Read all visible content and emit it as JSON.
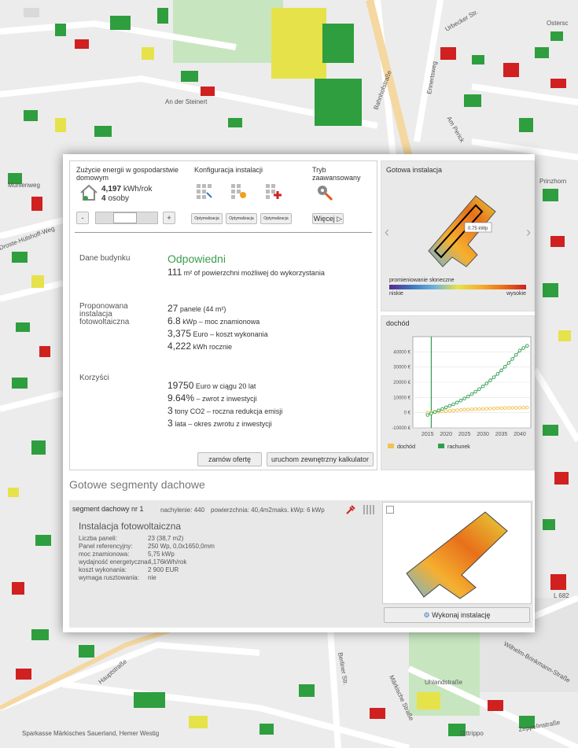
{
  "map": {
    "streets": [
      "An der Steinert",
      "Ennertsweg",
      "Bahnhofstraße",
      "Mühlenweg",
      "Prinzhorn",
      "Am Perick",
      "Hauptstraße",
      "Berliner Str.",
      "Wilhelm-Brinkmann-Straße",
      "Zeppelinstraße",
      "Märkische Straße",
      "Droste-Hülshoff-Weg",
      "Uhlandstraße",
      "L 682",
      "Ostersc",
      "Urbecker Str."
    ],
    "poi_label": "Sparkasse Märkisches Sauerland, Hemer Westig",
    "poi_label2": "Dittrippo"
  },
  "panel": {
    "top": {
      "consumption_title": "Zużycie energii w gospodarstwie domowym",
      "consumption_value": "4,197",
      "consumption_unit": "kWh/rok",
      "persons_value": "4",
      "persons_unit": "osoby",
      "minus": "-",
      "plus": "+",
      "config_title": "Konfiguracja instalacji",
      "config_btn1": "Optymalizacja",
      "config_btn2": "Optymalizacja",
      "config_btn3": "Optymalizacja",
      "advanced_title": "Tryb zaawansowany",
      "more_btn": "Więcej ▷"
    },
    "building": {
      "label": "Dane budynku",
      "status": "Odpowiedni",
      "area_value": "111",
      "area_text": "m² of powierzchni możliwej do wykorzystania"
    },
    "proposal": {
      "label": "Proponowana instalacja fotowoltaiczna",
      "l1_value": "27",
      "l1_text": "panele (44 m²)",
      "l2_value": "6.8",
      "l2_text": "kWp – moc znamionowa",
      "l3_value": "3,375",
      "l3_text": "Euro – koszt wykonania",
      "l4_value": "4,222",
      "l4_text": "kWh rocznie"
    },
    "benefits": {
      "label": "Korzyści",
      "l1_value": "19750",
      "l1_text": "Euro w ciągu 20 lat",
      "l2_value": "9.64%",
      "l2_text": "– zwrot z inwestycji",
      "l3_value": "3",
      "l3_text": "tony CO2 – roczna redukcja emisji",
      "l4_value": "3",
      "l4_text": "lata – okres zwrotu z inwestycji"
    },
    "buttons": {
      "order": "zamów ofertę",
      "external": "uruchom zewnętrzny kalkulator"
    },
    "ready": {
      "title": "Gotowa instalacja",
      "kwp_label": "0.75 kWp",
      "legend_title": "promieniowanie słoneczne",
      "low": "niskie",
      "high": "wysokie"
    },
    "segments_title": "Gotowe segmenty dachowe",
    "segment": {
      "name": "segment dachowy nr 1",
      "tilt": "nachylenie: 440",
      "area": "powierzchnia: 40,4m2",
      "max": "maks. kWp: 6 kWp",
      "inst_title": "Instalacja fotowoltaiczna",
      "rows": [
        {
          "k": "Liczba paneli:",
          "v": "23 (38,7 m2)"
        },
        {
          "k": "Panel referencyjny:",
          "v": "250 Wp, 0,0x1650,0mm"
        },
        {
          "k": "moc znamionowa:",
          "v": "5,75 kWp"
        },
        {
          "k": "wydajność energetyczna:",
          "v": "4,176kWh/rok"
        },
        {
          "k": "koszt wykonania:",
          "v": "2 900 EUR"
        },
        {
          "k": "wymaga rusztowania:",
          "v": "nie"
        }
      ],
      "execute_btn": "Wykonaj instalację"
    }
  },
  "chart_data": {
    "type": "line",
    "title": "dochód",
    "x": [
      2015,
      2016,
      2017,
      2018,
      2019,
      2020,
      2021,
      2022,
      2023,
      2024,
      2025,
      2026,
      2027,
      2028,
      2029,
      2030,
      2031,
      2032,
      2033,
      2034,
      2035,
      2036,
      2037,
      2038,
      2039,
      2040,
      2041,
      2042
    ],
    "series": [
      {
        "name": "dochód",
        "color": "#f2c14e",
        "values": [
          0,
          200,
          400,
          600,
          800,
          1000,
          1200,
          1400,
          1600,
          1800,
          2000,
          2100,
          2200,
          2300,
          2400,
          2500,
          2600,
          2700,
          2800,
          2900,
          3000,
          3050,
          3100,
          3150,
          3200,
          3250,
          3300,
          3350
        ]
      },
      {
        "name": "rachunek",
        "color": "#2f9e4f",
        "values": [
          -1500,
          -500,
          500,
          1500,
          2500,
          3500,
          4500,
          5500,
          6700,
          8000,
          9300,
          10700,
          12200,
          13800,
          15500,
          17300,
          19200,
          21200,
          23300,
          25500,
          27800,
          30200,
          32700,
          35300,
          38000,
          40800,
          42500,
          44000
        ]
      }
    ],
    "ylim": [
      -10000,
      50000
    ],
    "yticks": [
      "50000 €",
      "40000 €",
      "30000 €",
      "20000 €",
      "10000 €",
      "0 €",
      "-10000 €"
    ],
    "xticks": [
      "2015",
      "2020",
      "2025",
      "2030",
      "2035",
      "2040"
    ],
    "xlim": [
      2011,
      2043
    ],
    "marker_year": 2016
  }
}
